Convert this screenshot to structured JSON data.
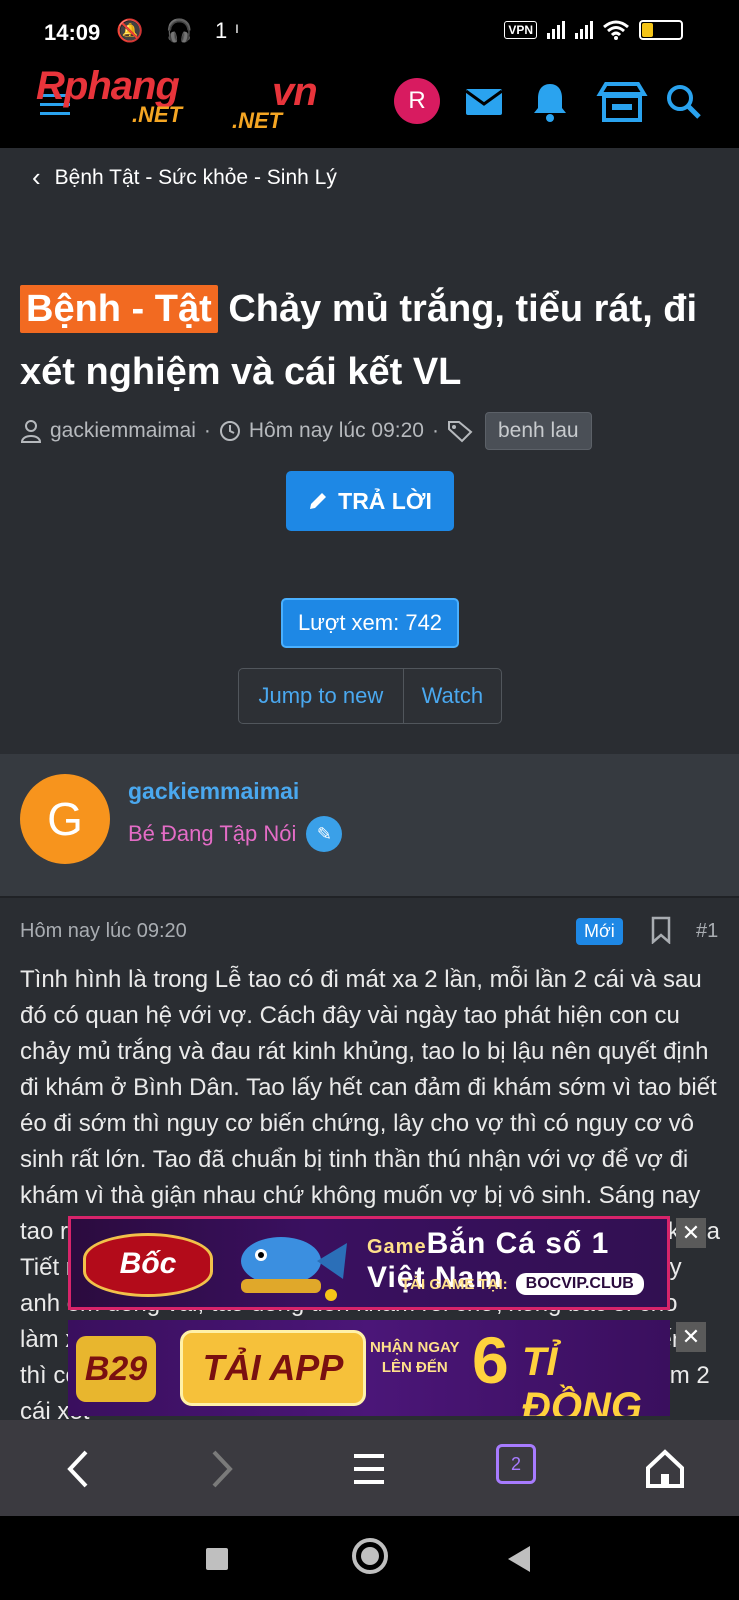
{
  "status_bar": {
    "time": "14:09",
    "extra_icons": "🔕 🎧 1ᶦ",
    "vpn": "VPN",
    "battery": "28"
  },
  "site": {
    "logo_part1": "Rphang",
    "logo_part2": "vn",
    "logo_net": ".NET",
    "logo_net2": ".NET",
    "user_initial": "R"
  },
  "breadcrumb": {
    "label": "Bệnh Tật - Sức khỏe - Sinh Lý"
  },
  "thread": {
    "prefix": "Bệnh - Tật",
    "title": "Chảy mủ trắng, tiểu rát, đi xét nghiệm và cái kết VL",
    "author": "gackiemmaimai",
    "date": "Hôm nay lúc 09:20",
    "tag": "benh lau"
  },
  "actions": {
    "reply": "TRẢ LỜI",
    "views": "Lượt xem: 742",
    "jump_to_new": "Jump to new",
    "watch": "Watch"
  },
  "author_card": {
    "initial": "G",
    "name": "gackiemmaimai",
    "rank": "Bé Đang Tập Nói"
  },
  "post": {
    "date": "Hôm nay lúc 09:20",
    "new_badge": "Mới",
    "number": "#1",
    "body": "Tình hình là trong Lễ tao có đi mát xa 2 lần, mỗi lần 2 cái và sau đó có quan hệ với vợ. Cách đây vài ngày tao phát hiện con cu chảy mủ trắng và đau rát kinh khủng, tao lo bị lậu nên quyết định đi khám ở Bình Dân. Tao lấy hết can đảm đi khám sớm vì tao biết éo đi sớm thì nguy cơ biến chứng, lây cho vợ thì có nguy cơ vô sinh rất lớn. Tao đã chuẩn bị tinh thần thú nhận với vợ để vợ đi khám vì thà giận nhau chứ không muốn vợ bị vô sinh. Sáng nay tao ra tận nơi và gia đình tao mỗi đứa một nơi, tao lên thẳng khoa Tiết niệu và đi khám ở lầu 3 Bệnh viện Bình Dân, đến nơi thấy anh em đông vãi, tao đóng tiền khám rồi chờ, xong bác sĩ cho làm xét nghiệm hết 95k tiền xét nghiệm, đợi kết quả hơn 1 tiếng thì có kết quả, bác sĩ kết luận tao chắc bị lậu rồi và cho tao làm 2 cái xét"
  },
  "ads": {
    "ad1_brand": "Bốc club",
    "ad1_game": "Game",
    "ad1_headline": "Bắn Cá số 1 Việt Nam",
    "ad1_sub": "TẢI GAME TẠI:",
    "ad1_url": "BOCVIP.CLUB",
    "ad2_brand": "B29",
    "ad2_cta": "TẢI APP",
    "ad2_note1": "NHẬN NGAY",
    "ad2_note2": "LÊN ĐẾN",
    "ad2_amount": "6",
    "ad2_unit": "TỈ ĐỒNG",
    "close": "✕"
  },
  "browser": {
    "tab_count": "2"
  }
}
